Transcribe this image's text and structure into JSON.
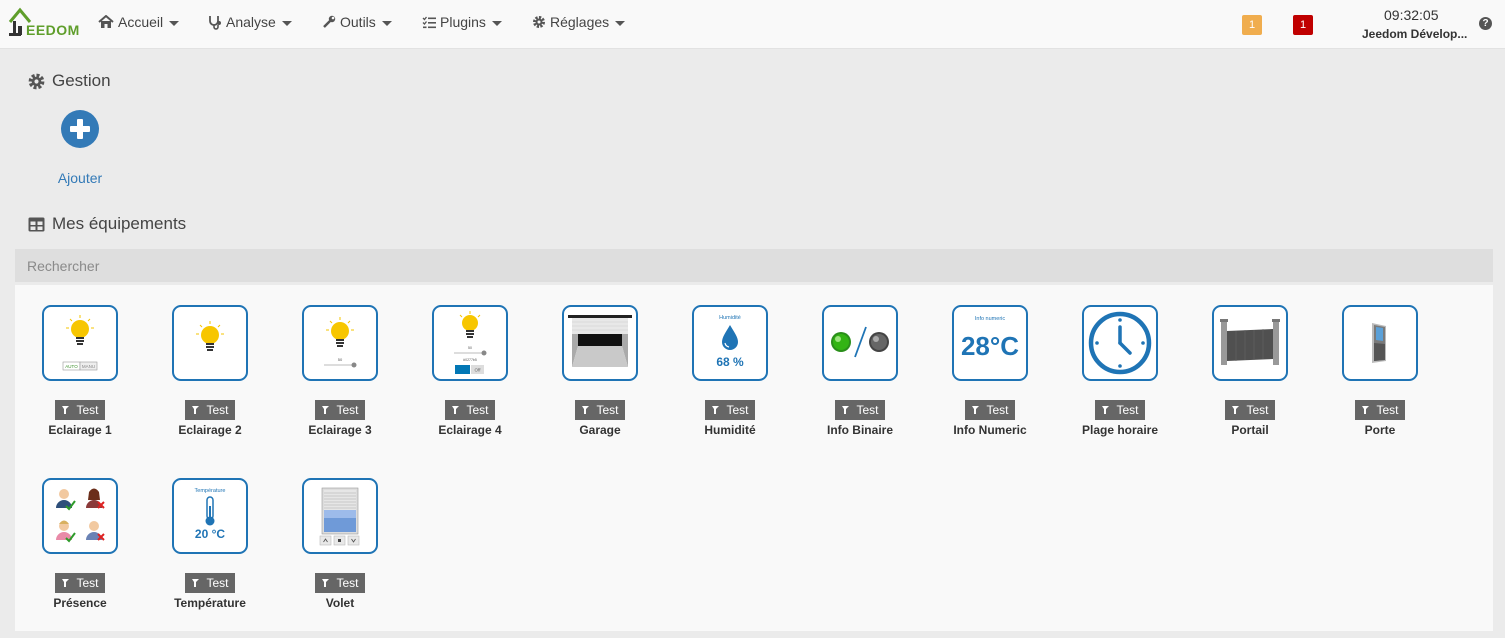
{
  "navbar": {
    "brand": "EEDOM",
    "menus": [
      {
        "label": "Accueil",
        "icon": "home-icon"
      },
      {
        "label": "Analyse",
        "icon": "stethoscope-icon"
      },
      {
        "label": "Outils",
        "icon": "wrench-icon"
      },
      {
        "label": "Plugins",
        "icon": "tasks-icon"
      },
      {
        "label": "Réglages",
        "icon": "gear-icon"
      }
    ],
    "badge_warning": "1",
    "badge_danger": "1",
    "time": "09:32:05",
    "user": "Jeedom Dévelop...",
    "help": "?"
  },
  "gestion": {
    "title": "Gestion",
    "add_label": "Ajouter"
  },
  "equipements": {
    "title": "Mes équipements",
    "search_placeholder": "Rechercher",
    "items": [
      {
        "tag": "Test",
        "name": "Eclairage 1",
        "icon": "bulb-auto-icon"
      },
      {
        "tag": "Test",
        "name": "Eclairage 2",
        "icon": "bulb-icon"
      },
      {
        "tag": "Test",
        "name": "Eclairage 3",
        "icon": "bulb-slider-icon"
      },
      {
        "tag": "Test",
        "name": "Eclairage 4",
        "icon": "bulb-color-icon"
      },
      {
        "tag": "Test",
        "name": "Garage",
        "icon": "garage-icon"
      },
      {
        "tag": "Test",
        "name": "Humidité",
        "icon": "humidity-icon"
      },
      {
        "tag": "Test",
        "name": "Info Binaire",
        "icon": "binary-icon"
      },
      {
        "tag": "Test",
        "name": "Info Numeric",
        "icon": "numeric-icon"
      },
      {
        "tag": "Test",
        "name": "Plage horaire",
        "icon": "clock-icon"
      },
      {
        "tag": "Test",
        "name": "Portail",
        "icon": "gate-icon"
      },
      {
        "tag": "Test",
        "name": "Porte",
        "icon": "door-icon"
      },
      {
        "tag": "Test",
        "name": "Présence",
        "icon": "presence-icon"
      },
      {
        "tag": "Test",
        "name": "Température",
        "icon": "thermometer-icon"
      },
      {
        "tag": "Test",
        "name": "Volet",
        "icon": "shutter-icon"
      }
    ],
    "widget_text": {
      "eclairage1_buttons": [
        "AUTO",
        "MANU"
      ],
      "slider_value": "50",
      "color_hex": "#0277b5",
      "switch_off": "Off",
      "humidite_label": "Humidité",
      "humidite_value": "68 %",
      "numeric_label": "Info numeric",
      "numeric_value": "28°C",
      "temp_label": "Température",
      "temp_value": "20 °C"
    }
  },
  "colors": {
    "accent": "#1f74b5",
    "link": "#337ab7",
    "badge_warning": "#f0ad4e",
    "badge_danger": "#c00000",
    "brand_green": "#5f9e2b"
  }
}
